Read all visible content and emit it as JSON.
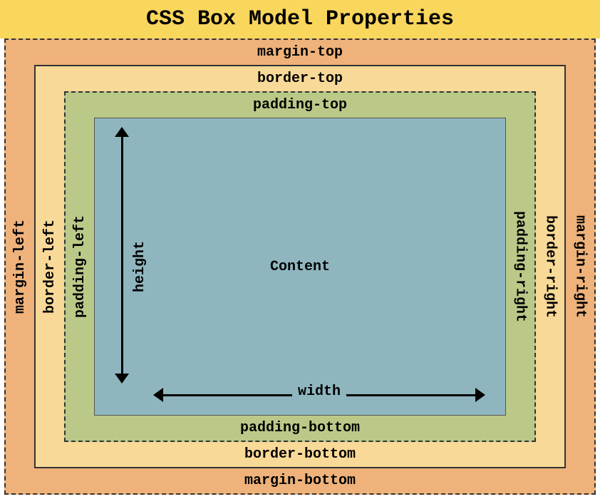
{
  "title": "CSS Box Model Properties",
  "margin": {
    "top": "margin-top",
    "bottom": "margin-bottom",
    "left": "margin-left",
    "right": "margin-right"
  },
  "border": {
    "top": "border-top",
    "bottom": "border-bottom",
    "left": "border-left",
    "right": "border-right"
  },
  "padding": {
    "top": "padding-top",
    "bottom": "padding-bottom",
    "left": "padding-left",
    "right": "padding-right"
  },
  "content": {
    "label": "Content",
    "height_label": "height",
    "width_label": "width"
  },
  "colors": {
    "title_bg": "#f9d65c",
    "margin_bg": "#eeb27a",
    "border_bg": "#f9d998",
    "padding_bg": "#bac988",
    "content_bg": "#8fb6bf"
  }
}
